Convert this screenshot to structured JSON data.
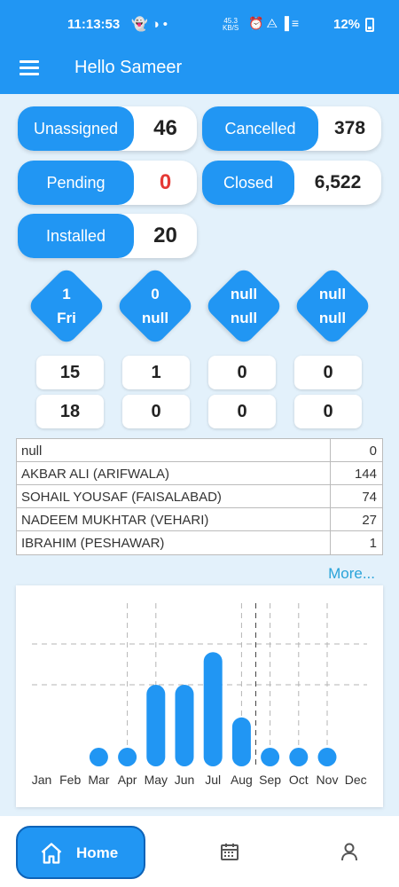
{
  "status_bar": {
    "time": "11:13:53",
    "speed_value": "45.3",
    "speed_unit": "KB/S",
    "battery": "12%",
    "icons": [
      "snapchat-icon",
      "tiktok-icon",
      "dot-icon",
      "alarm-icon",
      "wifi-icon",
      "signal-icon",
      "vowifi-icon",
      "battery-icon"
    ]
  },
  "app_bar": {
    "title": "Hello Sameer"
  },
  "stats": [
    {
      "label": "Unassigned",
      "value": "46"
    },
    {
      "label": "Cancelled",
      "value": "378"
    },
    {
      "label": "Pending",
      "value": "0"
    },
    {
      "label": "Closed",
      "value": "6,522"
    },
    {
      "label": "Installed",
      "value": "20"
    }
  ],
  "diamonds": [
    {
      "line1": "1",
      "line2": "Fri"
    },
    {
      "line1": "0",
      "line2": "null"
    },
    {
      "line1": "null",
      "line2": "null"
    },
    {
      "line1": "null",
      "line2": "null"
    }
  ],
  "counts_row1": [
    "15",
    "1",
    "0",
    "0"
  ],
  "counts_row2": [
    "18",
    "0",
    "0",
    "0"
  ],
  "table_rows": [
    {
      "name": "null",
      "count": "0"
    },
    {
      "name": "AKBAR ALI (ARIFWALA)",
      "count": "144"
    },
    {
      "name": "SOHAIL YOUSAF (FAISALABAD)",
      "count": "74"
    },
    {
      "name": "NADEEM MUKHTAR (VEHARI)",
      "count": "27"
    },
    {
      "name": "IBRAHIM (PESHAWAR)",
      "count": "1"
    }
  ],
  "more_link": "More...",
  "chart_data": {
    "type": "bar",
    "categories": [
      "Jan",
      "Feb",
      "Mar",
      "Apr",
      "May",
      "Jun",
      "Jul",
      "Aug",
      "Sep",
      "Oct",
      "Nov",
      "Dec"
    ],
    "values": [
      0,
      0,
      1,
      1,
      10,
      10,
      14,
      6,
      1,
      1,
      1,
      0
    ],
    "ylim": [
      0,
      20
    ],
    "grid": true,
    "color": "#2196f3"
  },
  "bottom_nav": {
    "home_label": "Home"
  },
  "colors": {
    "primary": "#2196f3",
    "background": "#e3f1fb",
    "alert": "#e53935",
    "link": "#29a3d9"
  }
}
